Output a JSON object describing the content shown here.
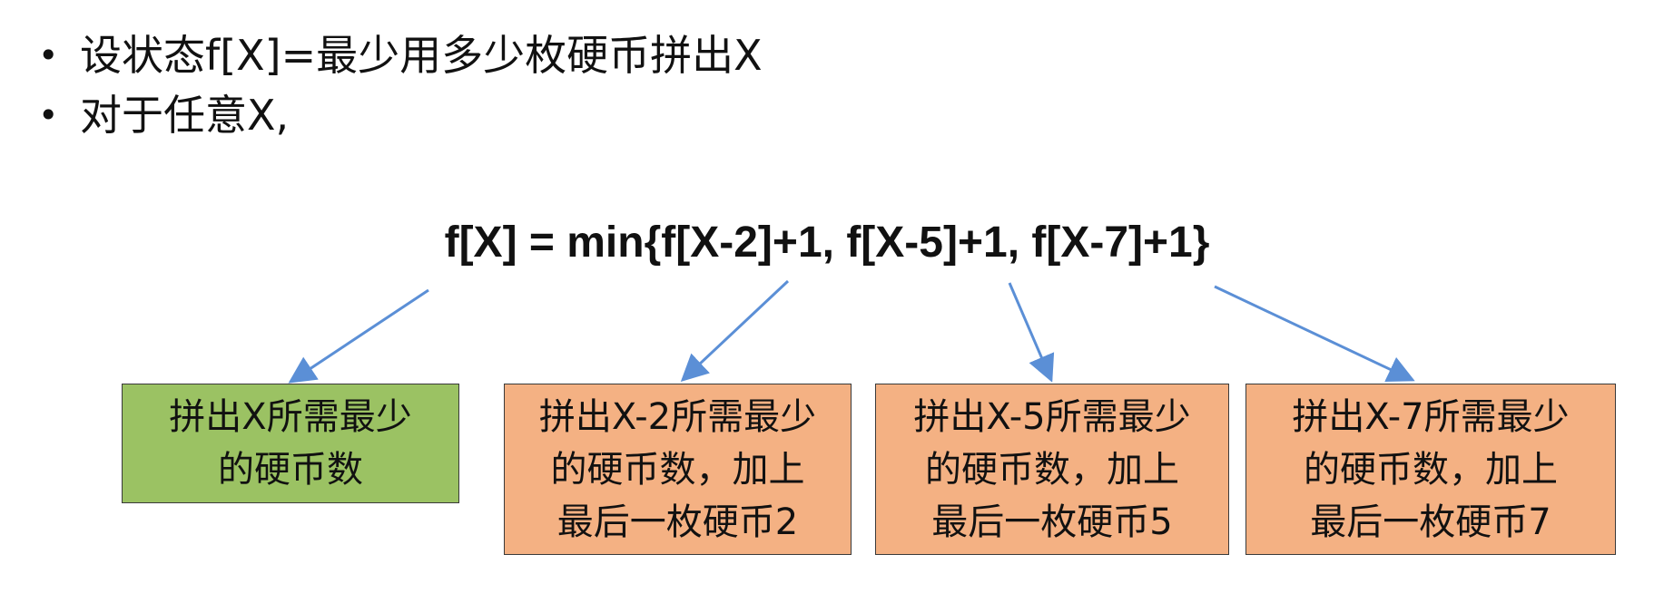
{
  "bullets": [
    "设状态f[X]=最少用多少枚硬币拼出X",
    "对于任意X,"
  ],
  "bullet_marker": "•",
  "formula": "f[X] = min{f[X-2]+1, f[X-5]+1, f[X-7]+1}",
  "boxes": [
    {
      "lines": [
        "拼出X所需最少",
        "的硬币数"
      ]
    },
    {
      "lines": [
        "拼出X-2所需最少",
        "的硬币数，加上",
        "最后一枚硬币2"
      ]
    },
    {
      "lines": [
        "拼出X-5所需最少",
        "的硬币数，加上",
        "最后一枚硬币5"
      ]
    },
    {
      "lines": [
        "拼出X-7所需最少",
        "的硬币数，加上",
        "最后一枚硬币7"
      ]
    }
  ],
  "colors": {
    "box_green": "#9bc263",
    "box_orange": "#f4b183",
    "arrow": "#5b8fd6"
  }
}
